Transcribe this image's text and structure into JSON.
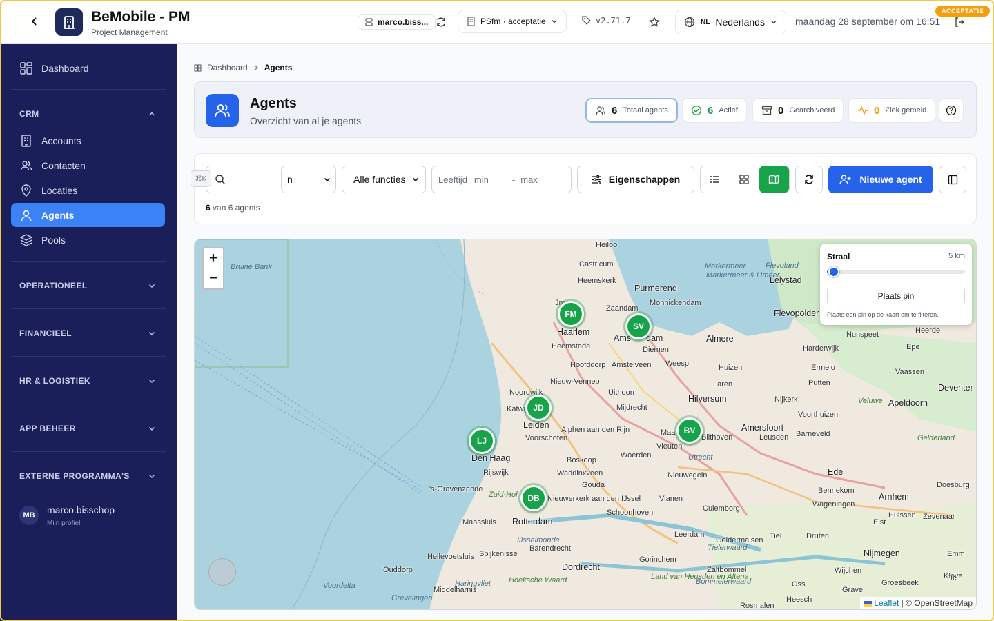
{
  "header": {
    "title": "BeMobile - PM",
    "subtitle": "Project Management",
    "user_chip": "marco.biss...",
    "environment": "PSfm · acceptatie",
    "version": "v2.71.7",
    "language_code": "NL",
    "language": "Nederlands",
    "datetime": "maandag 28 september om 16:51",
    "env_badge": "ACCEPTATIE"
  },
  "sidebar": {
    "dashboard": "Dashboard",
    "crm": {
      "title": "CRM",
      "items": [
        {
          "label": "Accounts",
          "icon": "building-icon"
        },
        {
          "label": "Contacten",
          "icon": "users-icon"
        },
        {
          "label": "Locaties",
          "icon": "map-pin-icon"
        },
        {
          "label": "Agents",
          "icon": "user-icon",
          "active": true
        },
        {
          "label": "Pools",
          "icon": "layers-icon"
        }
      ]
    },
    "sections": [
      "OPERATIONEEL",
      "FINANCIEEL",
      "HR & LOGISTIEK",
      "APP BEHEER",
      "EXTERNE PROGRAMMA'S"
    ],
    "user": {
      "initials": "MB",
      "name": "marco.bisschop",
      "profile": "Mijn profiel"
    }
  },
  "breadcrumb": {
    "home": "Dashboard",
    "current": "Agents"
  },
  "page": {
    "title": "Agents",
    "subtitle": "Overzicht van al je agents",
    "stats": [
      {
        "value": "6",
        "label": "Totaal agents"
      },
      {
        "value": "6",
        "label": "Actief"
      },
      {
        "value": "0",
        "label": "Gearchiveerd"
      },
      {
        "value": "0",
        "label": "Ziek gemeld"
      }
    ]
  },
  "filters": {
    "shortcut": "⌘K",
    "select_partial": "n",
    "function_select": "Alle functies",
    "age_label": "Leeftijd",
    "age_min_placeholder": "min",
    "age_sep": "-",
    "age_max_placeholder": "max",
    "properties_button": "Eigenschappen",
    "new_agent_button": "Nieuwe agent",
    "count_value": "6",
    "count_text": "van 6 agents"
  },
  "map": {
    "zoom_in": "+",
    "zoom_out": "−",
    "radius_title": "Straal",
    "radius_value": "5 km",
    "radius_level_fraction": 0.05,
    "pin_button": "Plaats pin",
    "pin_hint": "Plaats een pin op de kaart om te filteren.",
    "attribution_leaflet": "Leaflet",
    "attribution_osm": "| © OpenStreetMap",
    "markers": [
      "FM",
      "SV",
      "JD",
      "LJ",
      "BV",
      "DB"
    ],
    "places": [
      "Heiloo",
      "Castricum",
      "Heemskerk",
      "Purmerend",
      "Markermeer",
      "Flevoland",
      "Lelystad",
      "Markermeer & IJmeer",
      "Monnickendam",
      "IJm",
      "Zaandam",
      "Haarlem",
      "Ams",
      "dam",
      "Heemstede",
      "Diemen",
      "Flevopolder",
      "Almere",
      "Nunspeet",
      "Heerde",
      "Epe",
      "Harderwijk",
      "Hoofddorp",
      "Amstelveen",
      "Weesp",
      "Huizen",
      "Ermelo",
      "Vaassen",
      "Nieuw-Vennep",
      "Laren",
      "Putten",
      "Noordwijk",
      "Uithoorn",
      "Hilversum",
      "Deventer",
      "Katwij",
      "Leiden",
      "Mijdrecht",
      "Nijkerk",
      "Veluwe",
      "Apeldoorn",
      "Voorthuizen",
      "Alphen aan den Rijn",
      "Voorschoten",
      "Maar",
      "Bilthoven",
      "Amersfoort",
      "Leusden",
      "Barneveld",
      "Gelderland",
      "Den Haag",
      "Vleuten",
      "Utrecht",
      "Boskoop",
      "Rijswijk",
      "Woerden",
      "Waddinxveen",
      "Nieuwegein",
      "Ede",
      "'s-Gravenzande",
      "Gouda",
      "Doesburg",
      "Zuid-Hol",
      "Nieuwerkerk aan den IJssel",
      "Bennekom",
      "Arnhem",
      "Vianen",
      "Wageningen",
      "Maassluis",
      "Rotterdam",
      "Schoonhoven",
      "Culemborg",
      "Huissen",
      "Zevenaar",
      "Elst",
      "IJsselmonde",
      "Barendrecht",
      "Leerdam",
      "Geldermalsen",
      "Tiel",
      "Druten",
      "Tielerwaard",
      "Hellevoetsluis",
      "Spijkenisse",
      "Nijmegen",
      "Emm",
      "Gorinchem",
      "Wijchen",
      "Ouddorp",
      "Dordrecht",
      "Zaltbommel",
      "Land van Heusden en Altena",
      "Bommelerwaard",
      "Kleve",
      "Groesbeek",
      "Hoeksche Waard",
      "Oss",
      "Middelharnis",
      "Haringvliet",
      "Voordelta",
      "Grave",
      "Grevelingen",
      "Rosmalen",
      "Heesch",
      "Bruine Bank",
      "Dc"
    ]
  },
  "colors": {
    "sidebar": "#1a1f5a",
    "primary": "#2563eb",
    "active_nav": "#3b82f6",
    "marker": "#16a34a",
    "badge": "#f59e0b"
  }
}
